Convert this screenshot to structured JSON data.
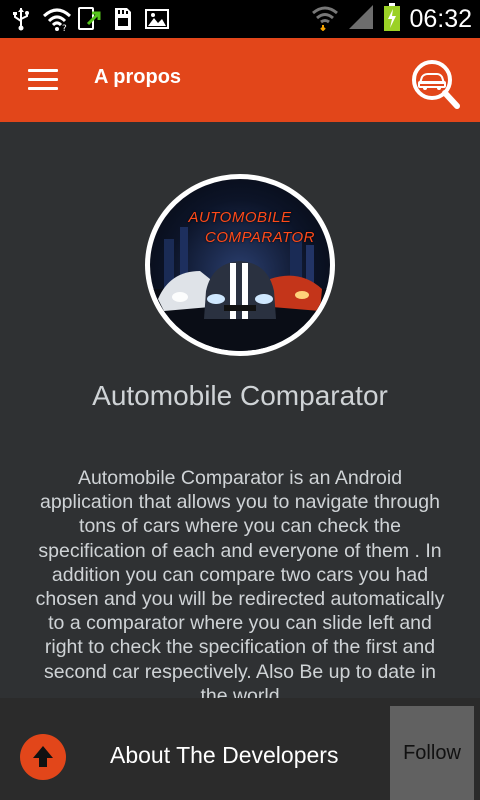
{
  "status_bar": {
    "time": "06:32",
    "icons": [
      "usb-icon",
      "wifi-icon",
      "screenshot-upload-icon",
      "sd-card-icon",
      "image-icon",
      "wifi-signal-icon",
      "cell-signal-icon",
      "battery-charging-icon"
    ]
  },
  "app_bar": {
    "title": "A propos",
    "menu_icon": "hamburger-menu-icon",
    "action_icon": "car-search-icon"
  },
  "main": {
    "logo_text_line1": "AUTOMOBILE",
    "logo_text_line2": "COMPARATOR",
    "app_name": "Automobile Comparator",
    "description": "Automobile Comparator is an Android application that allows you to navigate through tons of cars where you can check the specification of each and everyone of them . In addition you can compare two cars you had chosen and you will be redirected automatically to a comparator where you can slide left and right to check the specification of the first and second car respectively. Also Be up to date in the world"
  },
  "bottom_bar": {
    "label": "About The Developers",
    "follow_label": "Follow",
    "up_icon": "arrow-up-icon"
  },
  "colors": {
    "accent": "#e2461a",
    "background": "#2f3133",
    "bottom_bar": "#2b2b2b",
    "follow_button": "#616161"
  }
}
